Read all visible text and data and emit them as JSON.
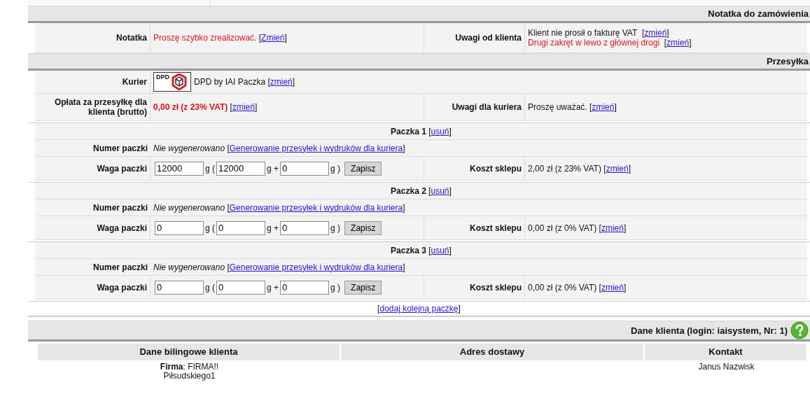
{
  "order_note": {
    "title": "Notatka do zamówienia",
    "note_label": "Notatka",
    "note_text": "Proszę szybko zrealizować.",
    "note_link": "[Zmień]",
    "client_label": "Uwagi od klienta",
    "client_remarks": [
      {
        "text": "Klient nie prosił o fakturę VAT",
        "highlighted": false,
        "link": "[zmień]"
      },
      {
        "text": "Drugi zakręt w lewo z głównej drogi",
        "highlighted": true,
        "link": "[zmień]"
      }
    ]
  },
  "shipment": {
    "title": "Przesyłka",
    "courier_label": "Kurier",
    "logo_text": "DPD",
    "courier_name": "DPD by IAI Paczka",
    "courier_link": "[zmień]",
    "fee_label": "Opłata za przesyłkę dla klienta (brutto)",
    "fee_value": "0,00 zł (z 23% VAT)",
    "fee_link": "[zmień]",
    "courier_notes_label": "Uwagi dla kuriera",
    "courier_notes": "Proszę uważać.",
    "courier_notes_link": "[zmień]",
    "packages": [
      {
        "title": "Paczka 1",
        "remove_link": "[usuń]",
        "number_label": "Numer paczki",
        "number_value": "Nie wygenerowano",
        "generate_link": "[Generowanie przesyłek i wydruków dla kuriera]",
        "weight_label": "Waga paczki",
        "weight_total": "12000",
        "unit_open": "g (",
        "weight_base": "12000",
        "unit_plus": "g +",
        "weight_extra": "0",
        "unit_close": "g )",
        "save_button": "Zapisz",
        "cost_label": "Koszt sklepu",
        "cost_value": "2,00 zł (z 23% VAT)",
        "cost_link": "[zmień]"
      },
      {
        "title": "Paczka 2",
        "remove_link": "[usuń]",
        "number_label": "Numer paczki",
        "number_value": "Nie wygenerowano",
        "generate_link": "[Generowanie przesyłek i wydruków dla kuriera]",
        "weight_label": "Waga paczki",
        "weight_total": "0",
        "unit_open": "g (",
        "weight_base": "0",
        "unit_plus": "g +",
        "weight_extra": "0",
        "unit_close": "g )",
        "save_button": "Zapisz",
        "cost_label": "Koszt sklepu",
        "cost_value": "0,00 zł (z 0% VAT)",
        "cost_link": "[zmień]"
      },
      {
        "title": "Paczka 3",
        "remove_link": "[usuń]",
        "number_label": "Numer paczki",
        "number_value": "Nie wygenerowano",
        "generate_link": "[Generowanie przesyłek i wydruków dla kuriera]",
        "weight_label": "Waga paczki",
        "weight_total": "0",
        "unit_open": "g (",
        "weight_base": "0",
        "unit_plus": "g +",
        "weight_extra": "0",
        "unit_close": "g )",
        "save_button": "Zapisz",
        "cost_label": "Koszt sklepu",
        "cost_value": "0,00 zł (z 0% VAT)",
        "cost_link": "[zmień]"
      }
    ],
    "add_package_link": "[dodaj kolejną paczkę]"
  },
  "client": {
    "title": "Dane klienta (login: iaisystem, Nr: 1)",
    "columns": [
      "Dane bilingowe klienta",
      "Adres dostawy",
      "Kontakt"
    ],
    "billing": [
      "**Firma**: FIRMA!!",
      "Piłsudskiego1"
    ],
    "contact": [
      "Janus Nazwisk"
    ]
  }
}
